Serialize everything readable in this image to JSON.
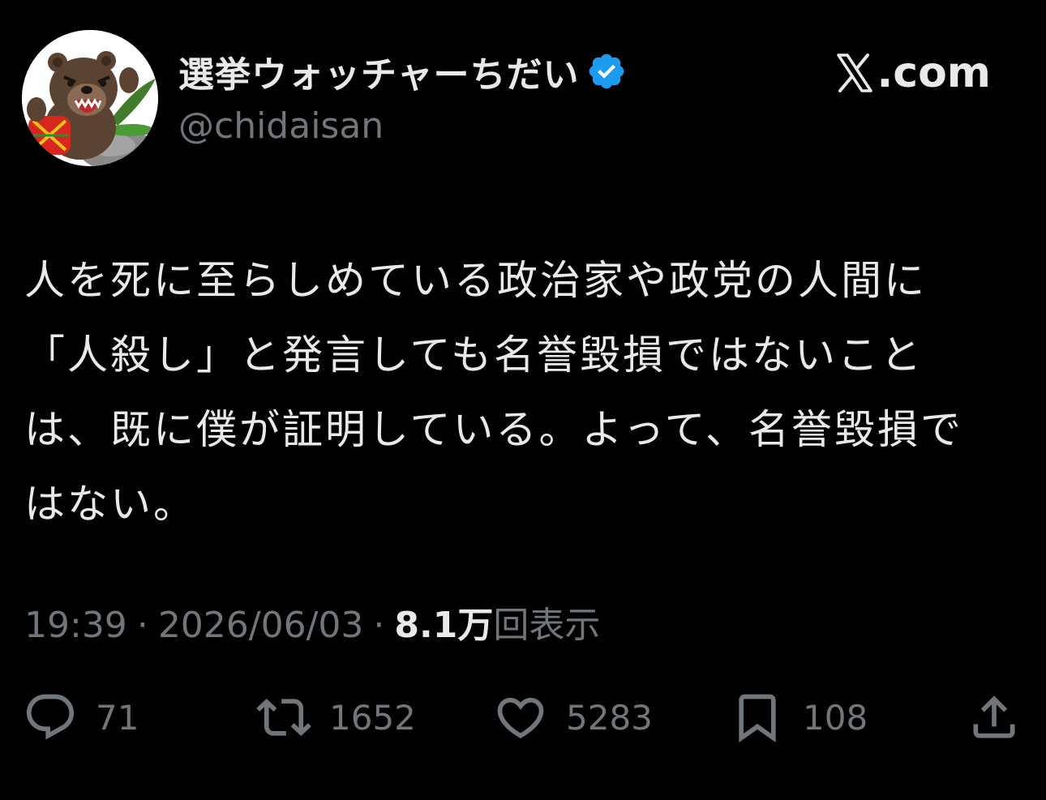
{
  "author": {
    "display_name": "選挙ウォッチャーちだい",
    "handle": "@chidaisan",
    "verified_icon": "verified-badge-icon",
    "avatar_icon": "bear-avatar"
  },
  "brand": {
    "text": ".com",
    "icon": "x-logo-icon"
  },
  "tweet": {
    "text": "人を死に至らしめている政治家や政党の人間に「人殺し」と発言しても名誉毀損ではないことは、既に僕が証明している。よって、名誉毀損ではない。"
  },
  "meta": {
    "time": "19:39",
    "separator": "·",
    "date": "2026/06/03",
    "views_count": "8.1万",
    "views_label": "回表示"
  },
  "actions": {
    "reply": {
      "icon": "reply-icon",
      "count": "71"
    },
    "retweet": {
      "icon": "retweet-icon",
      "count": "1652"
    },
    "like": {
      "icon": "heart-icon",
      "count": "5283"
    },
    "bookmark": {
      "icon": "bookmark-icon",
      "count": "108"
    },
    "share": {
      "icon": "share-icon"
    }
  },
  "colors": {
    "background": "#000000",
    "text_primary": "#e7e9ea",
    "text_secondary": "#71767b",
    "verified_blue": "#1d9bf0"
  }
}
